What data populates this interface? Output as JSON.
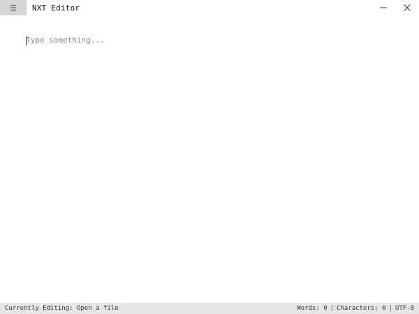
{
  "titlebar": {
    "menu_icon": "hamburger-menu-icon",
    "menu_glyph": "☰",
    "title": "NXT Editor",
    "minimize_icon": "minimize-icon",
    "close_icon": "close-icon"
  },
  "editor": {
    "placeholder": "Type something...",
    "value": ""
  },
  "statusbar": {
    "editing_label": "Currently Editing:",
    "editing_value": "Open a file",
    "words_label": "Words:",
    "words_count": "0",
    "chars_label": "Characters:",
    "chars_count": "0",
    "separator": "|",
    "encoding": "UTF-8"
  },
  "colors": {
    "menu_button_bg": "#d6d6d6",
    "statusbar_bg": "#e6e6e6",
    "placeholder": "#8a8a8a"
  }
}
